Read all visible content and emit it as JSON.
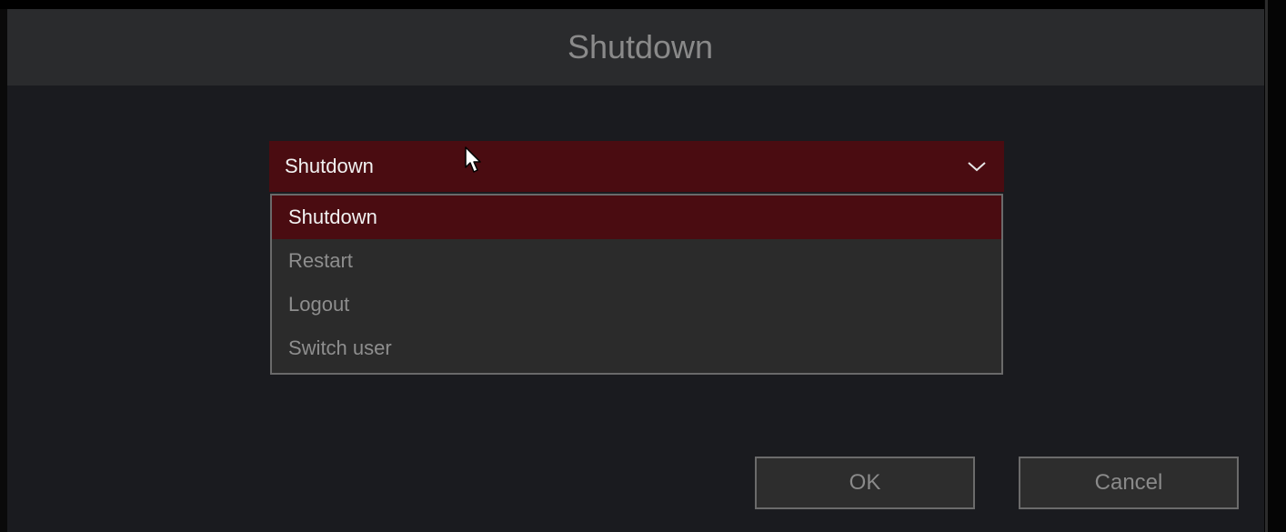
{
  "dialog": {
    "title": "Shutdown"
  },
  "select": {
    "value": "Shutdown",
    "icon": "chevron-down-icon",
    "options": [
      {
        "label": "Shutdown",
        "selected": true
      },
      {
        "label": "Restart",
        "selected": false
      },
      {
        "label": "Logout",
        "selected": false
      },
      {
        "label": "Switch user",
        "selected": false
      }
    ]
  },
  "buttons": {
    "ok_label": "OK",
    "cancel_label": "Cancel"
  },
  "colors": {
    "accent": "#4a0c11",
    "header_bg": "#2a2b2d",
    "dialog_bg": "#1a1b1f",
    "dropdown_bg": "#2b2b2b",
    "muted_text": "#8e8e8e"
  }
}
